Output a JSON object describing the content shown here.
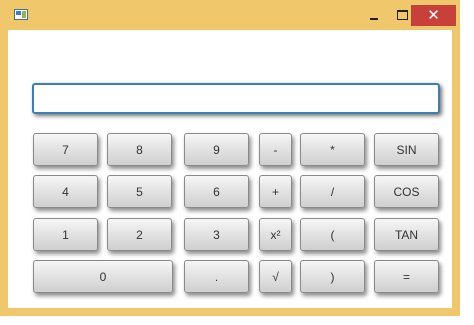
{
  "window": {
    "close_symbol": "✕"
  },
  "display": {
    "value": ""
  },
  "keys": {
    "seven": "7",
    "eight": "8",
    "nine": "9",
    "minus": "-",
    "multiply": "*",
    "sin": "SIN",
    "four": "4",
    "five": "5",
    "six": "6",
    "plus": "+",
    "divide": "/",
    "cos": "COS",
    "one": "1",
    "two": "2",
    "three": "3",
    "square": "x²",
    "open_paren": "(",
    "tan": "TAN",
    "zero": "0",
    "decimal": ".",
    "sqrt": "√",
    "close_paren": ")",
    "equals": "="
  },
  "colors": {
    "window_frame": "#f0c86b",
    "close_button": "#c7403a",
    "display_border": "#3c7fb1"
  }
}
